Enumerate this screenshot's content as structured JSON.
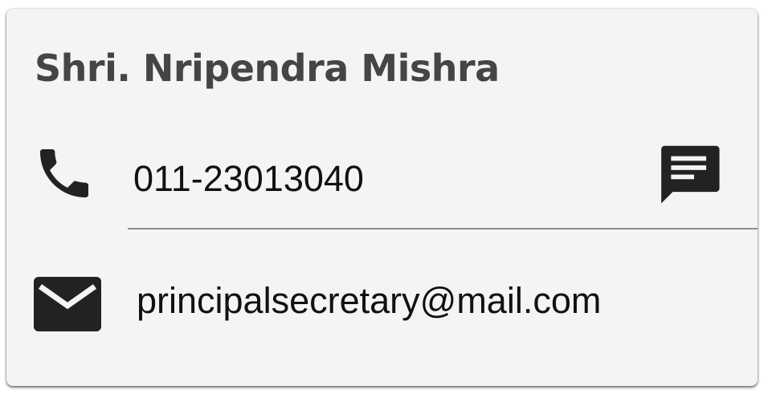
{
  "contact": {
    "name": "Shri. Nripendra Mishra",
    "phone": "011-23013040",
    "email": "principalsecretary@mail.com"
  },
  "icons": {
    "phone": "phone-icon",
    "message": "message-icon",
    "email": "mail-icon"
  },
  "colors": {
    "card_background": "#f4f4f4",
    "name_text": "#454545",
    "body_text": "#111111",
    "icon": "#222222",
    "divider": "#8c8c8c"
  }
}
